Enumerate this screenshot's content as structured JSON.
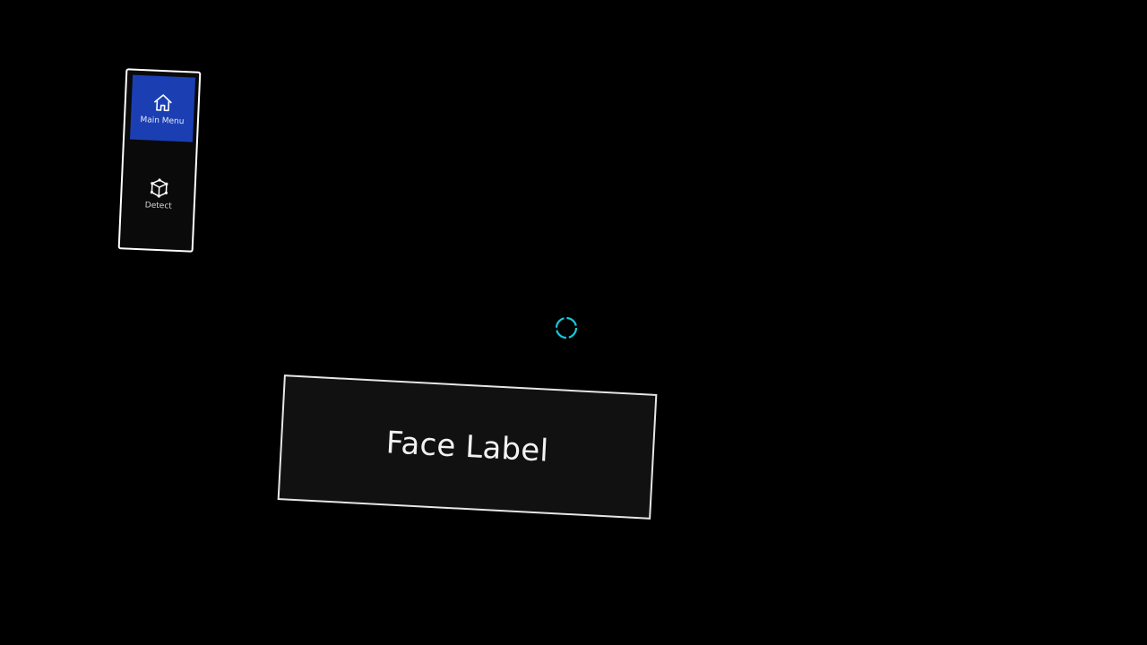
{
  "side_menu": {
    "items": [
      {
        "label": "Main Menu",
        "icon": "home-icon",
        "active": true
      },
      {
        "label": "Detect",
        "icon": "cube-icon",
        "active": false
      }
    ]
  },
  "cursor": {
    "icon": "gaze-cursor-icon",
    "color": "#17c8dc"
  },
  "face_card": {
    "text": "Face Label"
  },
  "colors": {
    "accent": "#1b3fb3",
    "background": "#000000",
    "border": "#ffffff"
  }
}
